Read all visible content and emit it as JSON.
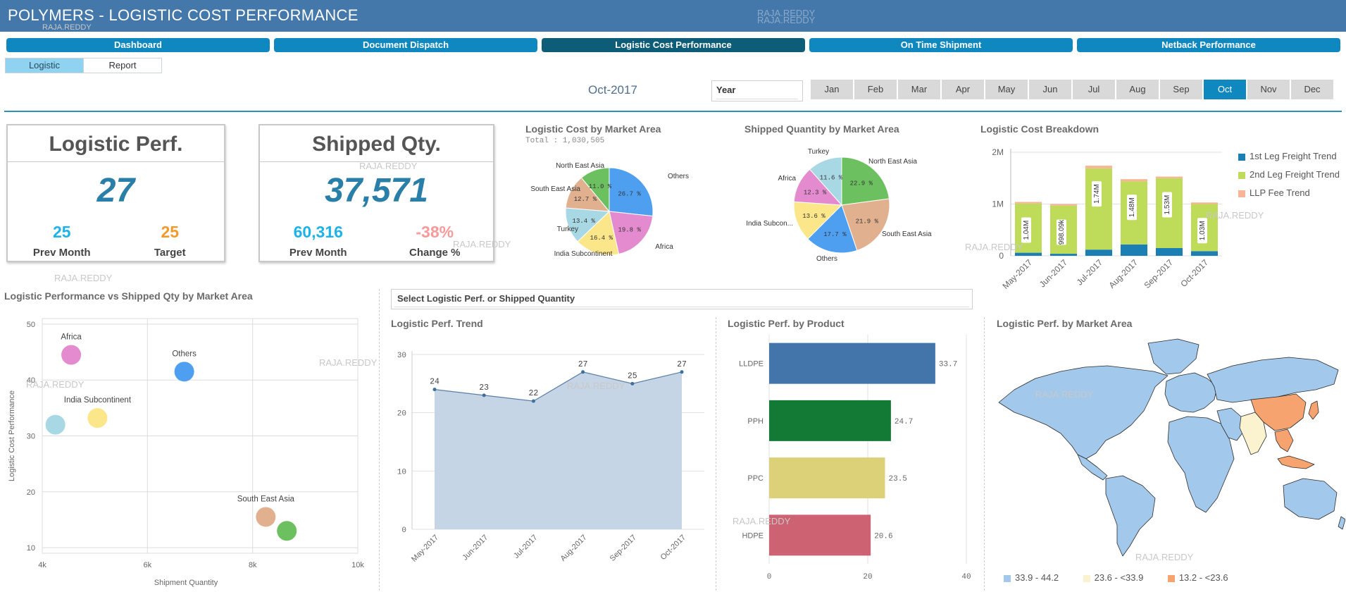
{
  "app": {
    "title": "POLYMERS - LOGISTIC COST PERFORMANCE",
    "watermark": "RAJA.REDDY"
  },
  "nav": {
    "tabs": [
      "Dashboard",
      "Document Dispatch",
      "Logistic Cost Performance",
      "On Time Shipment",
      "Netback Performance"
    ],
    "active": "Logistic Cost Performance"
  },
  "subtabs": {
    "items": [
      "Logistic",
      "Report"
    ],
    "active": "Logistic"
  },
  "filters": {
    "period": "Oct-2017",
    "year_label": "Year",
    "months": [
      "Jan",
      "Feb",
      "Mar",
      "Apr",
      "May",
      "Jun",
      "Jul",
      "Aug",
      "Sep",
      "Oct",
      "Nov",
      "Dec"
    ],
    "selected_month": "Oct"
  },
  "kpi_logistic": {
    "title": "Logistic Perf.",
    "value": "27",
    "prev_value": "25",
    "prev_label": "Prev Month",
    "target_value": "25",
    "target_label": "Target"
  },
  "kpi_shipped": {
    "title": "Shipped Qty.",
    "value": "37,571",
    "prev_value": "60,316",
    "prev_label": "Prev Month",
    "change_value": "-38%",
    "change_label": "Change %"
  },
  "colors": {
    "accent": "#0f88c0",
    "blue": "#4e9ff0",
    "green": "#6cc05f",
    "peach": "#e1b08f",
    "pink": "#e48bd0",
    "yellow": "#fce68a",
    "lightblue": "#a8d8e4"
  },
  "pie_cost": {
    "title": "Logistic Cost by Market Area",
    "total_label": "Total : 1,030,505",
    "chart_data": {
      "type": "pie",
      "slices": [
        {
          "label": "Others",
          "value": 26.7,
          "color": "#4e9ff0"
        },
        {
          "label": "Africa",
          "value": 19.8,
          "color": "#e48bd0"
        },
        {
          "label": "India Subcontinent",
          "value": 16.4,
          "color": "#fce68a"
        },
        {
          "label": "Turkey",
          "value": 13.4,
          "color": "#a8d8e4"
        },
        {
          "label": "South East Asia",
          "value": 12.7,
          "color": "#e1b08f"
        },
        {
          "label": "North East Asia",
          "value": 11.0,
          "color": "#6cc05f"
        }
      ]
    }
  },
  "pie_qty": {
    "title": "Shipped Quantity by Market Area",
    "chart_data": {
      "type": "pie",
      "slices": [
        {
          "label": "North East Asia",
          "value": 22.9,
          "color": "#6cc05f"
        },
        {
          "label": "South East Asia",
          "value": 21.9,
          "color": "#e1b08f"
        },
        {
          "label": "Others",
          "value": 17.7,
          "color": "#4e9ff0"
        },
        {
          "label": "India Subcon...",
          "value": 13.6,
          "color": "#fce68a"
        },
        {
          "label": "Africa",
          "value": 12.3,
          "color": "#e48bd0"
        },
        {
          "label": "Turkey",
          "value": 11.6,
          "color": "#a8d8e4"
        }
      ]
    }
  },
  "cost_breakdown": {
    "title": "Logistic Cost Breakdown",
    "chart_data": {
      "type": "bar",
      "categories": [
        "May-2017",
        "Jun-2017",
        "Jul-2017",
        "Aug-2017",
        "Sep-2017",
        "Oct-2017"
      ],
      "totals": [
        "1.04M",
        "998.09k",
        "1.74M",
        "1.48M",
        "1.53M",
        "1.03M"
      ],
      "series": [
        {
          "name": "1st Leg Freight Trend",
          "color": "#1b7fb3",
          "values": [
            0.06,
            0.04,
            0.12,
            0.22,
            0.15,
            0.09
          ]
        },
        {
          "name": "2nd Leg Freight Trend",
          "color": "#bedb5a",
          "values": [
            0.95,
            0.93,
            1.57,
            1.22,
            1.35,
            0.91
          ]
        },
        {
          "name": "LLP Fee Trend",
          "color": "#f8b496",
          "values": [
            0.03,
            0.03,
            0.05,
            0.04,
            0.03,
            0.03
          ]
        }
      ],
      "yticks": [
        "0",
        "1M",
        "2M"
      ],
      "ylim": [
        0,
        2
      ]
    }
  },
  "scatter": {
    "title": "Logistic Performance vs Shipped Qty by Market Area",
    "chart_data": {
      "type": "scatter",
      "xlabel": "Shipment Quantity",
      "ylabel": "Logistic Cost Performance",
      "xticks": [
        "4k",
        "6k",
        "8k",
        "10k"
      ],
      "yticks": [
        "10",
        "20",
        "30",
        "40",
        "50"
      ],
      "xlim": [
        4000,
        10000
      ],
      "ylim": [
        9,
        51
      ],
      "points": [
        {
          "label": "Africa",
          "x": 4550,
          "y": 44.5,
          "color": "#e48bd0"
        },
        {
          "label": "Others",
          "x": 6700,
          "y": 41.5,
          "color": "#4e9ff0"
        },
        {
          "label": "India Subcontinent",
          "x": 5050,
          "y": 33.2,
          "color": "#fce68a"
        },
        {
          "label": "",
          "x": 4250,
          "y": 32.0,
          "color": "#a8d8e4"
        },
        {
          "label": "South East Asia",
          "x": 8250,
          "y": 15.5,
          "color": "#e1b08f"
        },
        {
          "label": "",
          "x": 8650,
          "y": 13.0,
          "color": "#6cc05f"
        }
      ]
    }
  },
  "selector": {
    "label": "Select Logistic Perf. or Shipped Quantity"
  },
  "trend": {
    "title": "Logistic Perf. Trend",
    "chart_data": {
      "type": "area",
      "categories": [
        "May-2017",
        "Jun-2017",
        "Jul-2017",
        "Aug-2017",
        "Sep-2017",
        "Oct-2017"
      ],
      "values": [
        24,
        23,
        22,
        27,
        25,
        27
      ],
      "yticks": [
        "0",
        "10",
        "20",
        "30"
      ],
      "ylim": [
        0,
        30
      ]
    }
  },
  "by_product": {
    "title": "Logistic Perf. by Product",
    "chart_data": {
      "type": "bar",
      "categories": [
        "LLDPE",
        "PPH",
        "PPC",
        "HDPE"
      ],
      "values": [
        33.7,
        24.7,
        23.5,
        20.6
      ],
      "colors": [
        "#4375aa",
        "#137a35",
        "#dcd078",
        "#cd6273"
      ],
      "xticks": [
        "0",
        "20",
        "40"
      ],
      "xlim": [
        0,
        40
      ]
    }
  },
  "map": {
    "title": "Logistic Perf. by Market Area",
    "legend": [
      {
        "label": "33.9 - 44.2",
        "color": "#a2c8ec"
      },
      {
        "label": "23.6 - <33.9",
        "color": "#fbf3cf"
      },
      {
        "label": "13.2 - <23.6",
        "color": "#f6a36f"
      }
    ]
  }
}
